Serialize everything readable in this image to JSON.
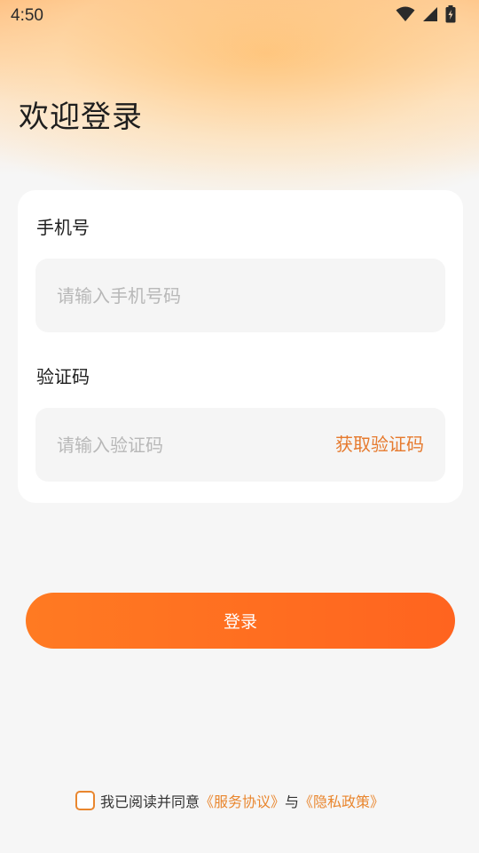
{
  "status_bar": {
    "time": "4:50",
    "icons": [
      "wifi-icon",
      "signal-icon",
      "battery-charging-icon"
    ]
  },
  "page": {
    "title": "欢迎登录"
  },
  "form": {
    "phone": {
      "label": "手机号",
      "placeholder": "请输入手机号码",
      "value": ""
    },
    "code": {
      "label": "验证码",
      "placeholder": "请输入验证码",
      "value": "",
      "get_code_label": "获取验证码"
    }
  },
  "login_button": {
    "label": "登录"
  },
  "agreement": {
    "checked": false,
    "prefix": "我已阅读并同意",
    "service_link": "《服务协议》",
    "joiner": "与",
    "privacy_link": "《隐私政策》"
  },
  "colors": {
    "accent": "#ff6a20",
    "link": "#e9862e",
    "background": "#f6f6f6"
  }
}
